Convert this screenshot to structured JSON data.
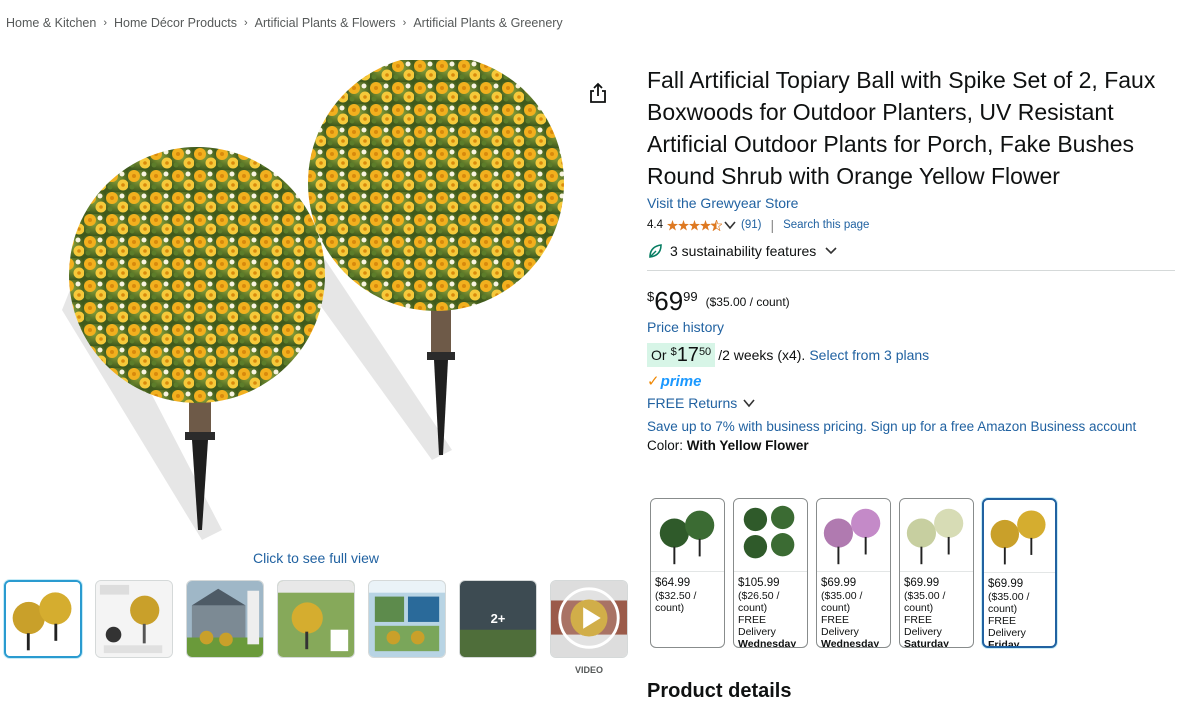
{
  "breadcrumb": [
    "Home & Kitchen",
    "Home Décor Products",
    "Artificial Plants & Flowers",
    "Artificial Plants & Greenery"
  ],
  "main_image": {
    "alt": "Topiary balls with orange yellow flowers",
    "full_view_label": "Click to see full view"
  },
  "thumbnails": {
    "more_label": "2+",
    "video_label": "VIDEO"
  },
  "product": {
    "title": "Fall Artificial Topiary Ball with Spike Set of 2, Faux Boxwoods for Outdoor Planters, UV Resistant Artificial Outdoor Plants for Porch, Fake Bushes Round Shrub with Orange Yellow Flower",
    "store_link": "Visit the Grewyear Store",
    "rating": "4.4",
    "rating_value": 4.4,
    "rating_count": "(91)",
    "search_page": "Search this page",
    "sustainability": "3 sustainability features"
  },
  "price": {
    "symbol": "$",
    "whole": "69",
    "fraction": "99",
    "unit": "($35.00 / count)",
    "history_link": "Price history",
    "installment": {
      "prefix": "Or",
      "symbol": "$",
      "whole": "17",
      "fraction": "50",
      "period": "/2 weeks (x4).",
      "plans_link": "Select from 3 plans"
    }
  },
  "prime": {
    "check": "✓",
    "word": "prime"
  },
  "returns": "FREE Returns",
  "business_link": "Save up to 7% with business pricing. Sign up for a free Amazon Business account",
  "color": {
    "label": "Color:",
    "selected": "With Yellow Flower"
  },
  "swatches": [
    {
      "price": "$64.99",
      "unit": "($32.50 / count)",
      "delivery": "",
      "day": ""
    },
    {
      "price": "$105.99",
      "unit": "($26.50 / count)",
      "delivery": "FREE Delivery",
      "day": "Wednesday"
    },
    {
      "price": "$69.99",
      "unit": "($35.00 / count)",
      "delivery": "FREE Delivery",
      "day": "Wednesday"
    },
    {
      "price": "$69.99",
      "unit": "($35.00 / count)",
      "delivery": "FREE Delivery",
      "day": "Saturday"
    },
    {
      "price": "$69.99",
      "unit": "($35.00 / count)",
      "delivery": "FREE Delivery",
      "day": "Friday"
    }
  ],
  "product_details_heading": "Product details",
  "colors": {
    "link": "#2162a1",
    "star": "#de7921",
    "install_bg": "#d7f5e7",
    "prime": "#1a98ff",
    "selected_border": "#2162a1"
  }
}
